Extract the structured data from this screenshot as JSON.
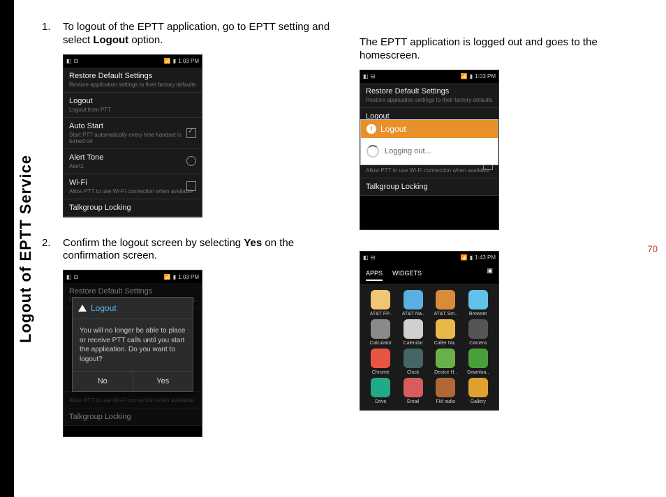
{
  "sidebar_title": "Logout of EPTT Service",
  "page_number": "70",
  "steps": {
    "s1_num": "1.",
    "s1_text_a": "To logout of the EPTT application, go to EPTT setting and select ",
    "s1_text_b": "Logout",
    "s1_text_c": " option.",
    "s2_num": "2.",
    "s2_text_a": "Confirm the logout screen by selecting ",
    "s2_text_b": "Yes",
    "s2_text_c": " on the confirmation screen.",
    "s3_text": "The EPTT application is logged out and goes to the homescreen."
  },
  "phone": {
    "time1": "1:03 PM",
    "time2": "1:03 PM",
    "time3": "1:03 PM",
    "time4": "1:43 PM",
    "settings": {
      "restore_title": "Restore Default Settings",
      "restore_sub": "Restore application settings to their factory defaults",
      "logout_title": "Logout",
      "logout_sub": "Logout from PTT",
      "auto_title": "Auto Start",
      "auto_sub": "Start PTT automatically every time handset is turned on",
      "alert_title": "Alert Tone",
      "alert_sub": "Alert1",
      "wifi_title": "Wi-Fi",
      "wifi_sub": "Allow PTT to use Wi-Fi connection when available",
      "talk_title": "Talkgroup Locking"
    },
    "dialog": {
      "title": "Logout",
      "body": "You will no longer be able to place or receive PTT calls until you start the application. Do you want to logout?",
      "no": "No",
      "yes": "Yes"
    },
    "toast": {
      "title": "Logout",
      "body": "Logging out..."
    },
    "home": {
      "tab_apps": "APPS",
      "tab_widgets": "WIDGETS",
      "apps": [
        {
          "name": "AT&T FP..",
          "color": "#f0c674"
        },
        {
          "name": "AT&T Na..",
          "color": "#59b0e0"
        },
        {
          "name": "AT&T Sm..",
          "color": "#d88c3a"
        },
        {
          "name": "Browser",
          "color": "#5fc2e8"
        },
        {
          "name": "Calculator",
          "color": "#8a8a8a"
        },
        {
          "name": "Calendar",
          "color": "#d0d0d0"
        },
        {
          "name": "Caller Na..",
          "color": "#e8b848"
        },
        {
          "name": "Camera",
          "color": "#555"
        },
        {
          "name": "Chrome",
          "color": "#e85642"
        },
        {
          "name": "Clock",
          "color": "#466"
        },
        {
          "name": "Device H..",
          "color": "#6ab04a"
        },
        {
          "name": "Downloa..",
          "color": "#48a038"
        },
        {
          "name": "Drive",
          "color": "#2a8"
        },
        {
          "name": "Email",
          "color": "#d85c5c"
        },
        {
          "name": "FM radio",
          "color": "#b06838"
        },
        {
          "name": "Gallery",
          "color": "#e0a030"
        }
      ]
    }
  }
}
